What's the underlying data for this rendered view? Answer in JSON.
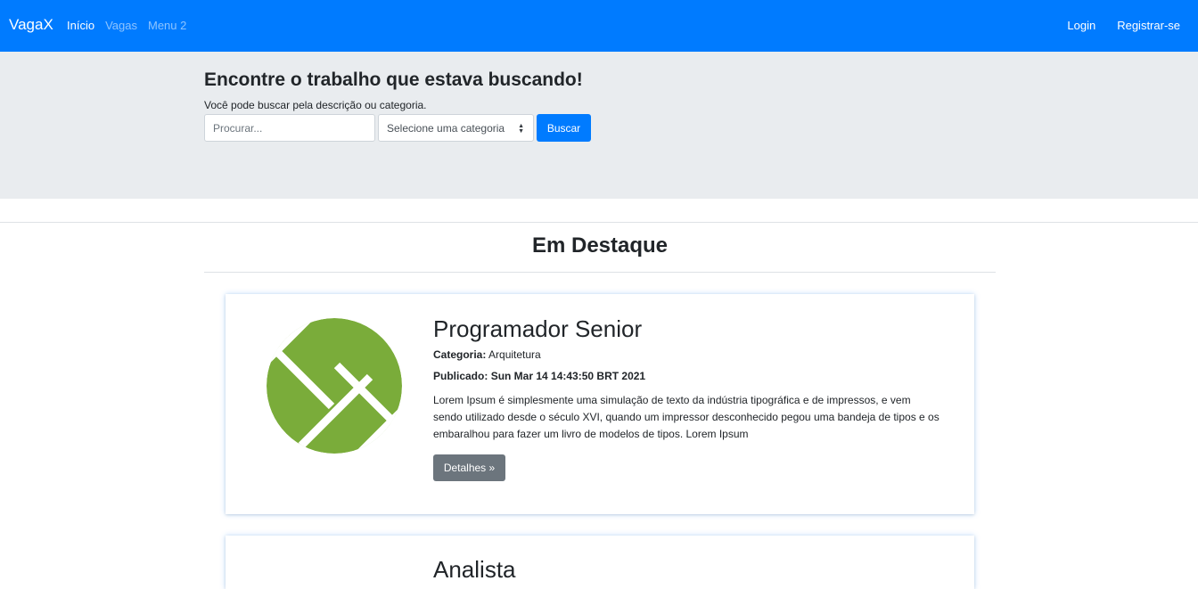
{
  "navbar": {
    "brand": "VagaX",
    "links": [
      "Início",
      "Vagas",
      "Menu 2"
    ],
    "login": "Login",
    "register": "Registrar-se",
    "color": "#007bff"
  },
  "hero": {
    "title": "Encontre o trabalho que estava buscando!",
    "subtitle": "Você pode buscar pela descrição ou categoria.",
    "search_placeholder": "Procurar...",
    "category_selected": "Selecione uma categoria",
    "search_button": "Buscar"
  },
  "featured": {
    "title": "Em Destaque",
    "jobs": [
      {
        "title": "Programador Senior",
        "category_label": "Categoria:",
        "category": "Arquitetura",
        "published_label": "Publicado:",
        "published": "Sun Mar 14 14:43:50 BRT 2021",
        "description": "Lorem Ipsum é simplesmente uma simulação de texto da indústria tipográfica e de impressos, e vem sendo utilizado desde o século XVI, quando um impressor desconhecido pegou uma bandeja de tipos e os embaralhou para fazer um livro de modelos de tipos. Lorem Ipsum",
        "details_button": "Detalhes »",
        "logo_icon": "green-circle-logo-icon",
        "logo_color": "#7aac3a"
      },
      {
        "title": "Analista"
      }
    ]
  }
}
